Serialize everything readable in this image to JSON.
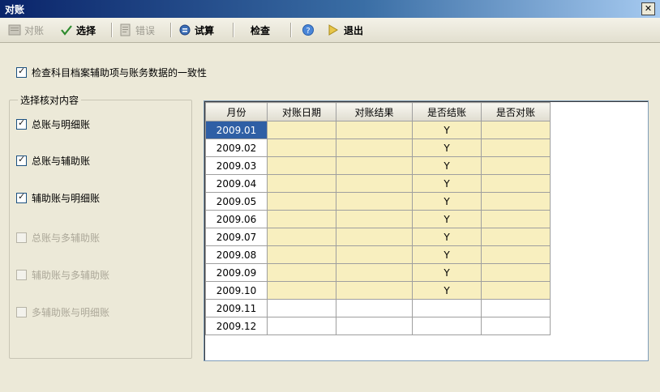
{
  "window": {
    "title": "对账",
    "close_label": "✕"
  },
  "toolbar": {
    "items": [
      {
        "label": "对账",
        "icon": "reconcile-icon",
        "disabled": true
      },
      {
        "label": "选择",
        "icon": "check-icon",
        "disabled": false
      },
      {
        "label": "错误",
        "icon": "error-list-icon",
        "disabled": true
      },
      {
        "label": "试算",
        "icon": "trial-balance-icon",
        "disabled": false
      },
      {
        "label": "检查",
        "icon": "",
        "disabled": false
      },
      {
        "label": "",
        "icon": "help-icon",
        "disabled": false
      },
      {
        "label": "退出",
        "icon": "exit-icon",
        "disabled": false
      }
    ]
  },
  "top_option": {
    "label": "检查科目档案辅助项与账务数据的一致性",
    "checked": true
  },
  "group": {
    "title": "选择核对内容",
    "options": [
      {
        "label": "总账与明细账",
        "checked": true,
        "enabled": true
      },
      {
        "label": "总账与辅助账",
        "checked": true,
        "enabled": true
      },
      {
        "label": "辅助账与明细账",
        "checked": true,
        "enabled": true
      },
      {
        "label": "总账与多辅助账",
        "checked": false,
        "enabled": false
      },
      {
        "label": "辅助账与多辅助账",
        "checked": false,
        "enabled": false
      },
      {
        "label": "多辅助账与明细账",
        "checked": false,
        "enabled": false
      }
    ]
  },
  "grid": {
    "columns": [
      "月份",
      "对账日期",
      "对账结果",
      "是否结账",
      "是否对账"
    ],
    "rows": [
      {
        "month": "2009.01",
        "date": "",
        "result": "",
        "closed": "Y",
        "reconciled": ""
      },
      {
        "month": "2009.02",
        "date": "",
        "result": "",
        "closed": "Y",
        "reconciled": ""
      },
      {
        "month": "2009.03",
        "date": "",
        "result": "",
        "closed": "Y",
        "reconciled": ""
      },
      {
        "month": "2009.04",
        "date": "",
        "result": "",
        "closed": "Y",
        "reconciled": ""
      },
      {
        "month": "2009.05",
        "date": "",
        "result": "",
        "closed": "Y",
        "reconciled": ""
      },
      {
        "month": "2009.06",
        "date": "",
        "result": "",
        "closed": "Y",
        "reconciled": ""
      },
      {
        "month": "2009.07",
        "date": "",
        "result": "",
        "closed": "Y",
        "reconciled": ""
      },
      {
        "month": "2009.08",
        "date": "",
        "result": "",
        "closed": "Y",
        "reconciled": ""
      },
      {
        "month": "2009.09",
        "date": "",
        "result": "",
        "closed": "Y",
        "reconciled": ""
      },
      {
        "month": "2009.10",
        "date": "",
        "result": "",
        "closed": "Y",
        "reconciled": ""
      },
      {
        "month": "2009.11",
        "date": "",
        "result": "",
        "closed": "",
        "reconciled": ""
      },
      {
        "month": "2009.12",
        "date": "",
        "result": "",
        "closed": "",
        "reconciled": ""
      }
    ],
    "selected_row": 0,
    "highlight_color": "#f8efbf",
    "selection_color": "#2f5fa5"
  }
}
